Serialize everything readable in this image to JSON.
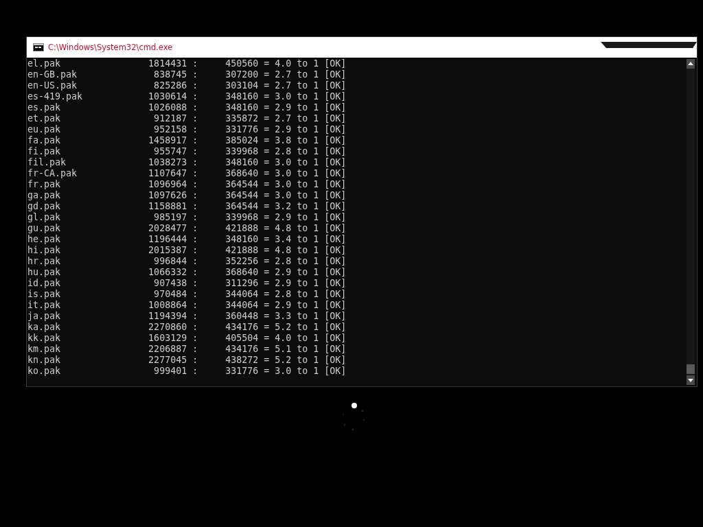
{
  "window": {
    "title": "C:\\Windows\\System32\\cmd.exe"
  },
  "console": {
    "lines": [
      "el.pak                1814431 :     450560 = 4.0 to 1 [OK]",
      "en-GB.pak              838745 :     307200 = 2.7 to 1 [OK]",
      "en-US.pak              825286 :     303104 = 2.7 to 1 [OK]",
      "es-419.pak            1030614 :     348160 = 3.0 to 1 [OK]",
      "es.pak                1026088 :     348160 = 2.9 to 1 [OK]",
      "et.pak                 912187 :     335872 = 2.7 to 1 [OK]",
      "eu.pak                 952158 :     331776 = 2.9 to 1 [OK]",
      "fa.pak                1458917 :     385024 = 3.8 to 1 [OK]",
      "fi.pak                 955747 :     339968 = 2.8 to 1 [OK]",
      "fil.pak               1038273 :     348160 = 3.0 to 1 [OK]",
      "fr-CA.pak             1107647 :     368640 = 3.0 to 1 [OK]",
      "fr.pak                1096964 :     364544 = 3.0 to 1 [OK]",
      "ga.pak                1097626 :     364544 = 3.0 to 1 [OK]",
      "gd.pak                1158881 :     364544 = 3.2 to 1 [OK]",
      "gl.pak                 985197 :     339968 = 2.9 to 1 [OK]",
      "gu.pak                2028477 :     421888 = 4.8 to 1 [OK]",
      "he.pak                1196444 :     348160 = 3.4 to 1 [OK]",
      "hi.pak                2015387 :     421888 = 4.8 to 1 [OK]",
      "hr.pak                 996844 :     352256 = 2.8 to 1 [OK]",
      "hu.pak                1066332 :     368640 = 2.9 to 1 [OK]",
      "id.pak                 907438 :     311296 = 2.9 to 1 [OK]",
      "is.pak                 970484 :     344064 = 2.8 to 1 [OK]",
      "it.pak                1008864 :     344064 = 2.9 to 1 [OK]",
      "ja.pak                1194394 :     360448 = 3.3 to 1 [OK]",
      "ka.pak                2270860 :     434176 = 5.2 to 1 [OK]",
      "kk.pak                1603129 :     405504 = 4.0 to 1 [OK]",
      "km.pak                2206887 :     434176 = 5.1 to 1 [OK]",
      "kn.pak                2277045 :     438272 = 5.2 to 1 [OK]",
      "ko.pak                 999401 :     331776 = 3.0 to 1 [OK]"
    ]
  }
}
